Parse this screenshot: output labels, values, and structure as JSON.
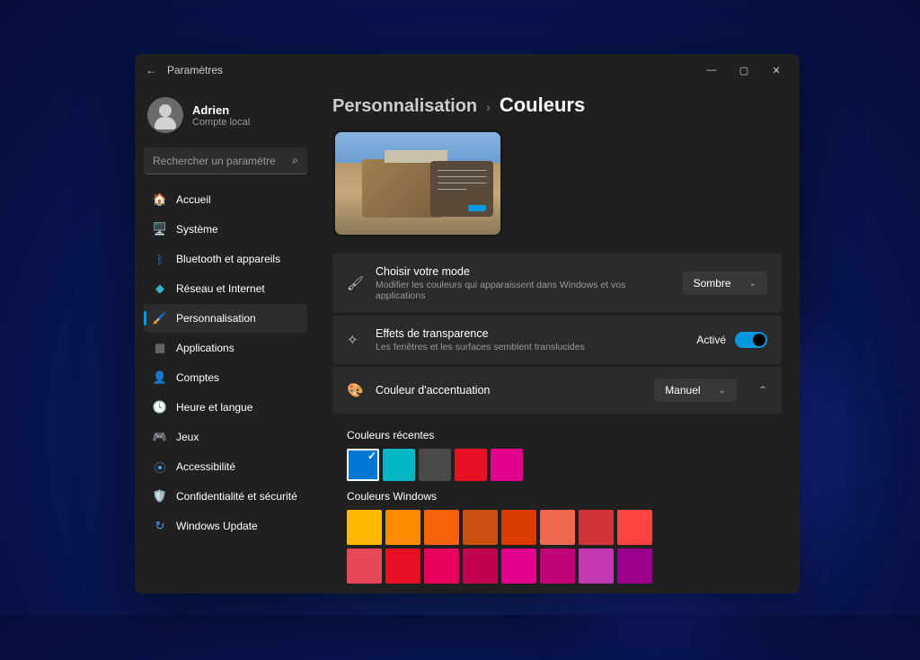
{
  "titlebar": {
    "title": "Paramètres"
  },
  "profile": {
    "name": "Adrien",
    "sub": "Compte local"
  },
  "search": {
    "placeholder": "Rechercher un paramètre"
  },
  "sidebar": {
    "items": [
      {
        "id": "accueil",
        "label": "Accueil",
        "icon": "🏠",
        "color": "#e58e3e"
      },
      {
        "id": "systeme",
        "label": "Système",
        "icon": "🖥️",
        "color": "#4a9de8"
      },
      {
        "id": "bluetooth",
        "label": "Bluetooth et appareils",
        "icon": "ᛒ",
        "color": "#3a76d8",
        "iconbg": "#3a76d8"
      },
      {
        "id": "reseau",
        "label": "Réseau et Internet",
        "icon": "◆",
        "color": "#3ab6c8"
      },
      {
        "id": "personnalisation",
        "label": "Personnalisation",
        "icon": "🖌️",
        "color": "#c8a858",
        "active": true
      },
      {
        "id": "applications",
        "label": "Applications",
        "icon": "▦",
        "color": "#888"
      },
      {
        "id": "comptes",
        "label": "Comptes",
        "icon": "👤",
        "color": "#3ab686"
      },
      {
        "id": "heure",
        "label": "Heure et langue",
        "icon": "🕓",
        "color": "#888"
      },
      {
        "id": "jeux",
        "label": "Jeux",
        "icon": "🎮",
        "color": "#888"
      },
      {
        "id": "accessibilite",
        "label": "Accessibilité",
        "icon": "⦿",
        "color": "#4a9de8"
      },
      {
        "id": "confidentialite",
        "label": "Confidentialité et sécurité",
        "icon": "🛡️",
        "color": "#888"
      },
      {
        "id": "update",
        "label": "Windows Update",
        "icon": "↻",
        "color": "#4a9de8"
      }
    ]
  },
  "breadcrumb": {
    "root": "Personnalisation",
    "leaf": "Couleurs"
  },
  "settings": {
    "mode": {
      "title": "Choisir votre mode",
      "sub": "Modifier les couleurs qui apparaissent dans Windows et vos applications",
      "value": "Sombre"
    },
    "transparency": {
      "title": "Effets de transparence",
      "sub": "Les fenêtres et les surfaces semblent translucides",
      "state": "Activé"
    },
    "accent": {
      "title": "Couleur d'accentuation",
      "value": "Manuel"
    }
  },
  "recent": {
    "title": "Couleurs récentes",
    "colors": [
      "#0078d4",
      "#00b7c3",
      "#4a4a4a",
      "#e81123",
      "#e3008c"
    ],
    "selected": 0
  },
  "windowsColors": {
    "title": "Couleurs Windows",
    "rows": [
      [
        "#ffb900",
        "#ff8c00",
        "#f7630c",
        "#ca5010",
        "#da3b01",
        "#ef6950",
        "#d13438",
        "#ff4343"
      ],
      [
        "#e74856",
        "#e81123",
        "#ea005e",
        "#c30052",
        "#e3008c",
        "#bf0077",
        "#c239b3",
        "#9a0089"
      ]
    ]
  }
}
